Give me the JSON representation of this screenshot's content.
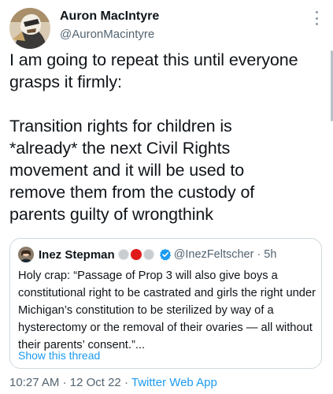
{
  "author": {
    "name": "Auron MacIntyre",
    "handle": "@AuronMacintyre"
  },
  "tweet": {
    "paragraph_1": "I am going to repeat this until everyone\ngrasps it firmly:",
    "paragraph_2": "Transition rights for children is\n*already* the next Civil Rights\nmovement and it will be used to\nremove them from the custody of\nparents guilty of wrongthink"
  },
  "quoted_tweet": {
    "name": "Inez Stepman",
    "handle": "@InezFeltscher",
    "separator": "·",
    "time": "5h",
    "text": "Holy crap: “Passage of Prop 3 will also give boys a constitutional right to be castrated and girls the right under Michigan’s constitution to be sterilized by way of a hysterectomy or the removal of their ovaries — all without their parents’ consent.”...",
    "show_thread": "Show this thread"
  },
  "meta": {
    "time": "10:27 AM",
    "separator": "·",
    "date": "12 Oct 22",
    "app": "Twitter Web App"
  },
  "colors": {
    "link": "#1d9bf0",
    "secondary_text": "#536471",
    "badge_red": "#e0191b"
  },
  "icons": {
    "more": "more-vertical-icon",
    "verified": "verified-badge-icon"
  }
}
